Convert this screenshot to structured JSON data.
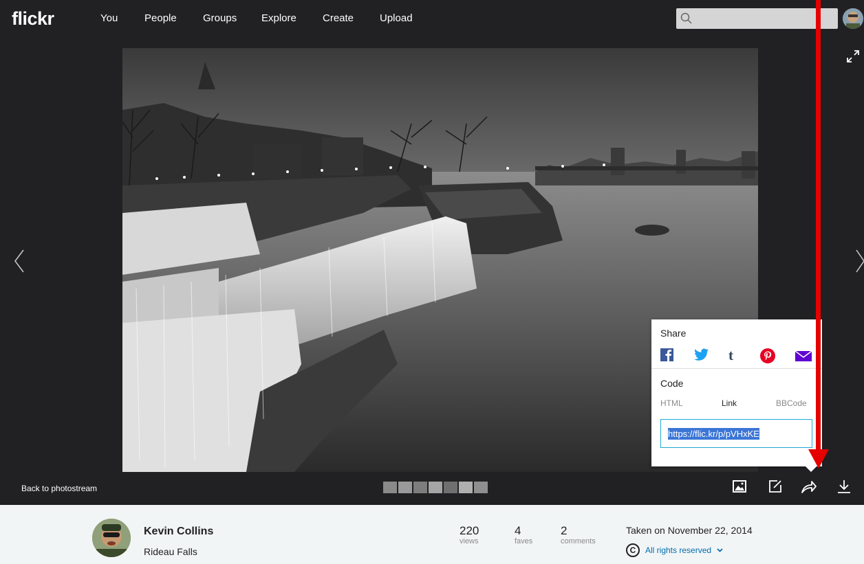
{
  "topbar": {
    "logo": "flickr",
    "nav": [
      "You",
      "People",
      "Groups",
      "Explore",
      "Create",
      "Upload"
    ]
  },
  "viewer": {
    "back_label": "Back to photostream"
  },
  "share": {
    "title": "Share",
    "icons": [
      "facebook-icon",
      "twitter-icon",
      "tumblr-icon",
      "pinterest-icon",
      "email-icon"
    ],
    "code_title": "Code",
    "tabs": [
      "HTML",
      "Link",
      "BBCode"
    ],
    "active_tab": "Link",
    "link_value": "https://flic.kr/p/pVHxKE"
  },
  "owner": {
    "name": "Kevin Collins",
    "photo_title": "Rideau Falls"
  },
  "stats": [
    {
      "num": "220",
      "label": "views"
    },
    {
      "num": "4",
      "label": "faves"
    },
    {
      "num": "2",
      "label": "comments"
    }
  ],
  "meta": {
    "taken": "Taken on November 22, 2014",
    "rights": "All rights reserved",
    "copyright_symbol": "C"
  },
  "colors": {
    "dark_bg": "#212124",
    "annotation_red": "#e60000",
    "link_blue": "#006dac"
  }
}
